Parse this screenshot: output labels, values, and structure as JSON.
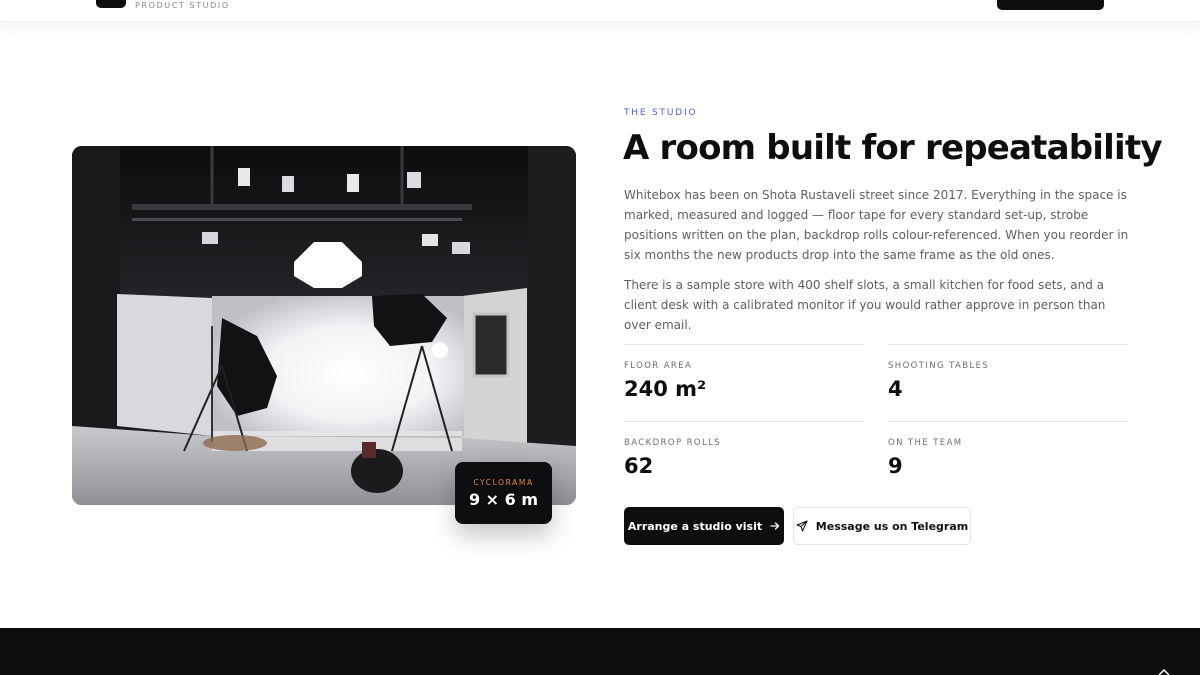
{
  "header": {
    "brand_subtitle": "PRODUCT STUDIO"
  },
  "photo": {
    "alt": "Photo studio with white cyclorama, softbox umbrellas and lighting rig",
    "badge": {
      "label": "CYCLORAMA",
      "value": "9 × 6 m"
    }
  },
  "section": {
    "eyebrow": "THE STUDIO",
    "title": "A room built for repeatability",
    "paragraphs": [
      "Whitebox has been on Shota Rustaveli street since 2017. Everything in the space is marked, measured and logged — floor tape for every standard set-up, strobe positions written on the plan, backdrop rolls colour-referenced. When you reorder in six months the new products drop into the same frame as the old ones.",
      "There is a sample store with 400 shelf slots, a small kitchen for food sets, and a client desk with a calibrated monitor if you would rather approve in person than over email."
    ],
    "stats": [
      {
        "label": "FLOOR AREA",
        "value": "240 m²"
      },
      {
        "label": "SHOOTING TABLES",
        "value": "4"
      },
      {
        "label": "BACKDROP ROLLS",
        "value": "62"
      },
      {
        "label": "ON THE TEAM",
        "value": "9"
      }
    ],
    "buttons": {
      "primary": "Arrange a studio visit",
      "secondary": "Message us on Telegram"
    }
  },
  "colors": {
    "accent_blue": "#4a5fd1",
    "accent_orange": "#e28a3b",
    "ink": "#0e0e10"
  },
  "icons": {
    "primary_button": "arrow-right-icon",
    "secondary_button": "telegram-send-icon"
  }
}
